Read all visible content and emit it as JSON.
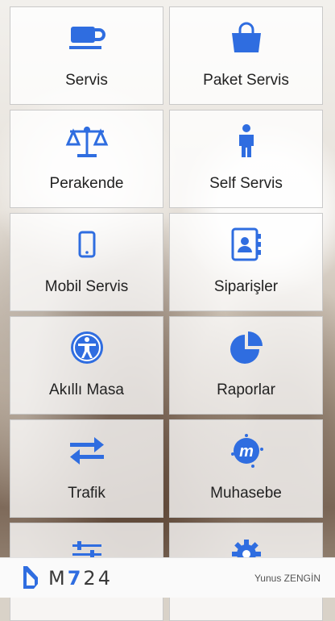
{
  "colors": {
    "accent": "#2f6de0"
  },
  "tiles": [
    {
      "label": "Servis",
      "icon": "coffee-cup-icon"
    },
    {
      "label": "Paket Servis",
      "icon": "shopping-bag-icon"
    },
    {
      "label": "Perakende",
      "icon": "balance-scale-icon"
    },
    {
      "label": "Self Servis",
      "icon": "person-icon"
    },
    {
      "label": "Mobil Servis",
      "icon": "mobile-phone-icon"
    },
    {
      "label": "Siparişler",
      "icon": "address-book-icon"
    },
    {
      "label": "Akıllı Masa",
      "icon": "accessibility-icon"
    },
    {
      "label": "Raporlar",
      "icon": "pie-chart-icon"
    },
    {
      "label": "Trafik",
      "icon": "exchange-arrows-icon"
    },
    {
      "label": "Muhasebe",
      "icon": "meetup-icon"
    },
    {
      "label": "",
      "icon": "sliders-icon"
    },
    {
      "label": "",
      "icon": "gear-icon"
    }
  ],
  "footer": {
    "logo_prefix": "M",
    "logo_accent": "7",
    "logo_suffix": "24",
    "user_name": "Yunus ZENGİN"
  }
}
